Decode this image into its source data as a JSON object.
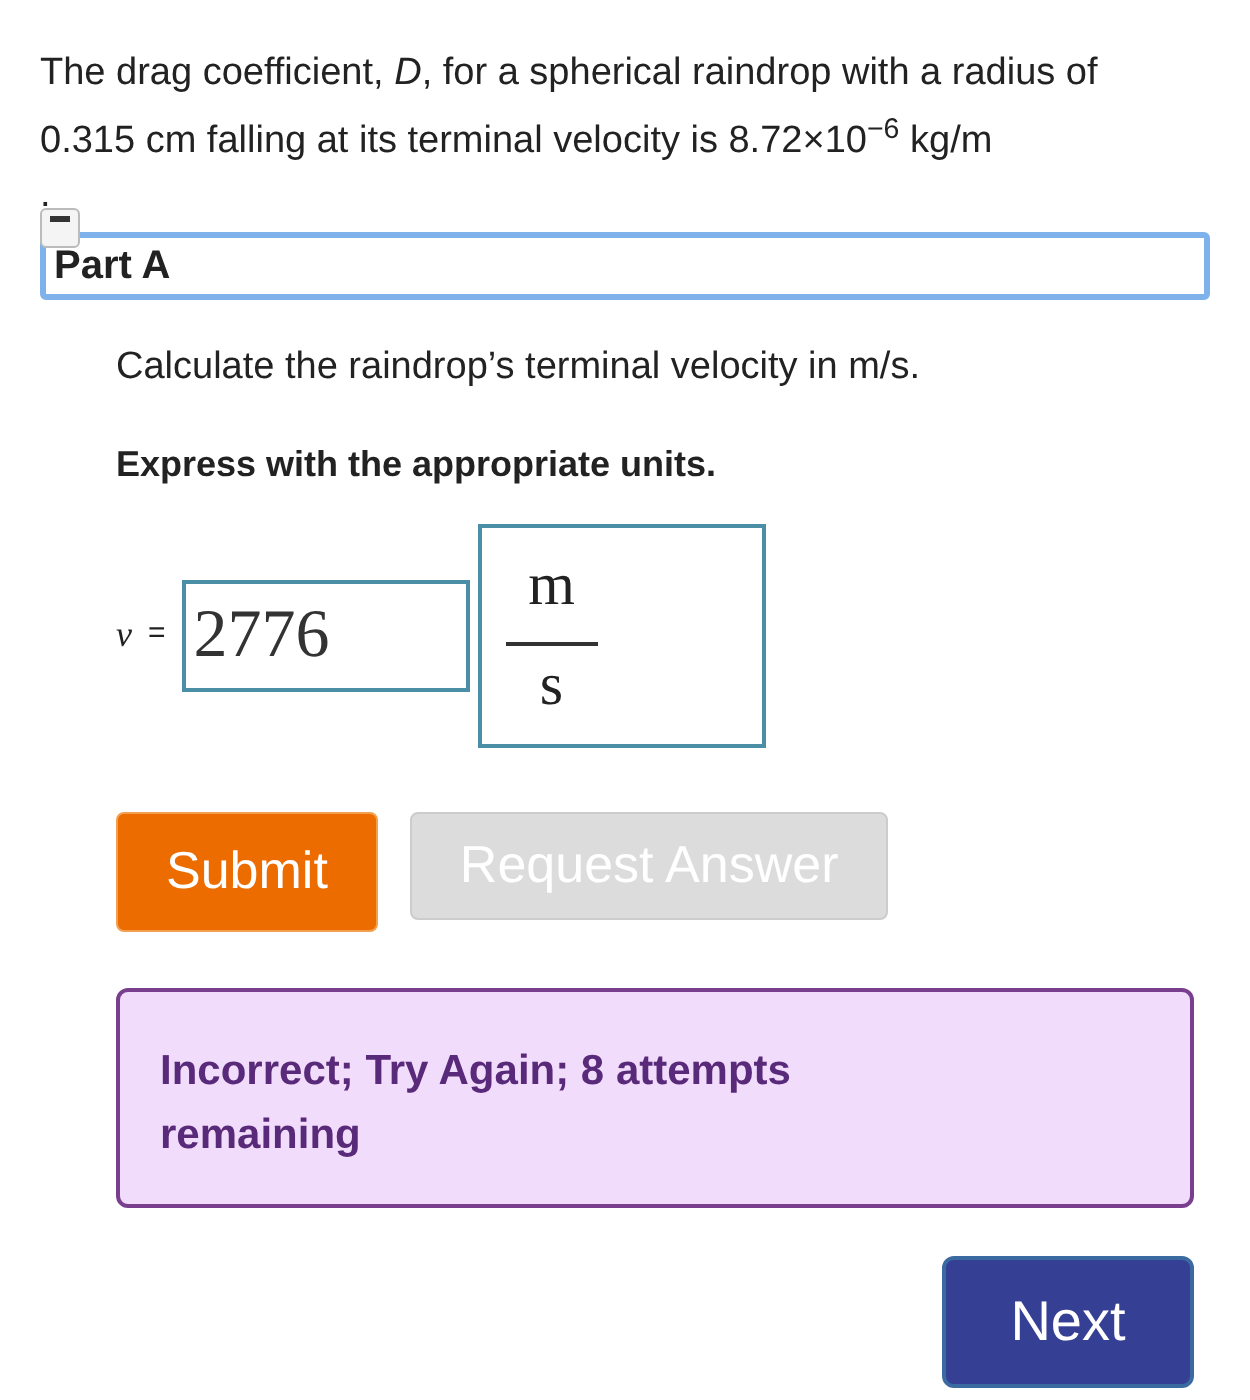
{
  "problem": {
    "text": "The drag coefficient, *D*, for a spherical raindrop with a radius of 0.315 cm falling at its terminal velocity is 8.72×10$^{−6}$ kg/m",
    "trailing": "."
  },
  "part": {
    "title": "Part A",
    "expanded": true,
    "focused": true
  },
  "question": "Calculate the raindrop’s terminal velocity in m/s.",
  "instruction": "Express with the appropriate units.",
  "answer": {
    "variable": "v",
    "equals": "=",
    "value": "2776",
    "unit_numerator": "m",
    "unit_denominator": "s"
  },
  "buttons": [
    {
      "label": "Submit",
      "kind": "primary",
      "disabled": false
    },
    {
      "label": "Request Answer",
      "kind": "secondary",
      "disabled": true
    }
  ],
  "feedback": {
    "text": "Incorrect; Try Again; 8 attempts remaining"
  },
  "next_button": {
    "label": "Next"
  }
}
